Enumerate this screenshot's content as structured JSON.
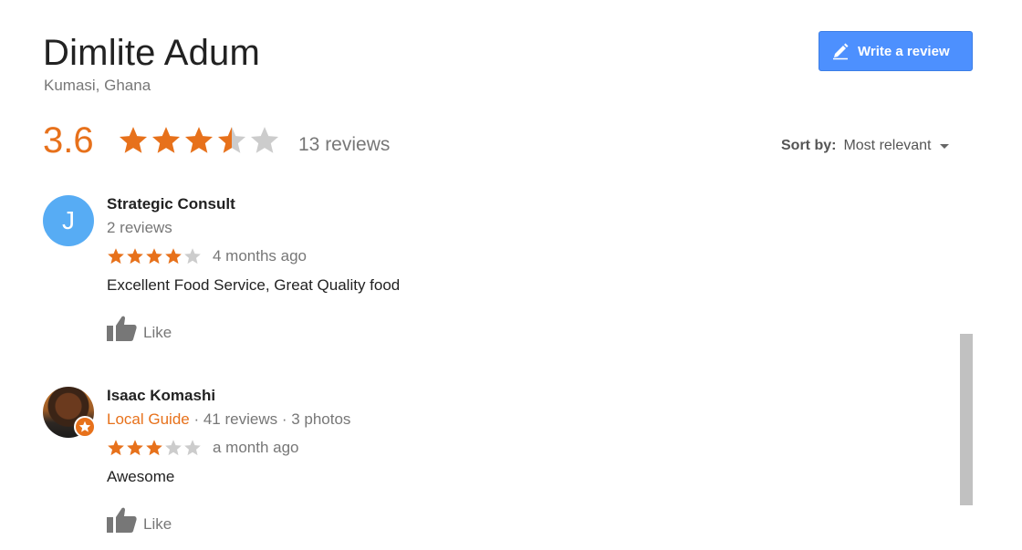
{
  "place": {
    "title": "Dimlite Adum",
    "location": "Kumasi, Ghana"
  },
  "actions": {
    "write_review_label": "Write a review"
  },
  "summary": {
    "rating": "3.6",
    "rating_value": 3.6,
    "reviews_count": "13 reviews"
  },
  "sort": {
    "label": "Sort by:",
    "value": "Most relevant"
  },
  "colors": {
    "accent": "#e7711b",
    "button": "#4d90fe",
    "avatar_blue": "#57acf4",
    "star_empty": "#cccccc"
  },
  "reviews": [
    {
      "avatar_letter": "J",
      "name": "Strategic Consult",
      "local_guide": "",
      "meta": "2 reviews",
      "stars": 4,
      "time": "4 months ago",
      "text": "Excellent Food Service, Great Quality food",
      "like_label": "Like"
    },
    {
      "avatar_letter": "",
      "name": "Isaac Komashi",
      "local_guide": "Local Guide",
      "meta": " · 41 reviews · 3 photos",
      "stars": 3,
      "time": "a month ago",
      "text": "Awesome",
      "like_label": "Like"
    }
  ]
}
